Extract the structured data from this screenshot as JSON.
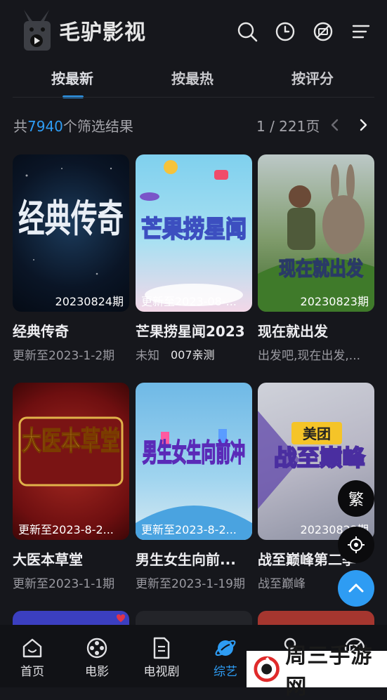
{
  "app": {
    "name": "毛驴影视"
  },
  "top_icons": [
    "search-icon",
    "history-icon",
    "no-ads-icon",
    "menu-icon"
  ],
  "tabs": [
    {
      "label": "按最新",
      "active": true
    },
    {
      "label": "按最热",
      "active": false
    },
    {
      "label": "按评分",
      "active": false
    }
  ],
  "filter": {
    "prefix": "共",
    "count": "7940",
    "suffix": "个筛选结果",
    "page": "1 / 221页"
  },
  "cards": [
    {
      "poster_text": "20230824期",
      "title": "经典传奇",
      "subtitle": "更新至2023-1-2期",
      "poster_art": "经典传奇"
    },
    {
      "poster_text": "更新至2023-08-...",
      "title": "芒果捞星闻2023",
      "subtitle": "未知",
      "subtitle_extra": "007亲测",
      "poster_art": "芒果捞星闻"
    },
    {
      "poster_text": "20230823期",
      "title": "现在就出发",
      "subtitle": "出发吧,现在出发,...",
      "poster_art": "现在就出发"
    },
    {
      "poster_text": "更新至2023-8-2...",
      "title": "大医本草堂",
      "subtitle": "更新至2023-1-1期",
      "poster_art": "大医本草堂"
    },
    {
      "poster_text": "更新至2023-8-2...",
      "title": "男生女生向前...",
      "subtitle": "更新至2023-1-19期",
      "poster_art": "男生女生向前冲"
    },
    {
      "poster_text": "20230823期",
      "title": "战至巅峰第二季",
      "subtitle": "战至巅峰",
      "poster_art": "战至巅峰",
      "poster_brand": "美团"
    }
  ],
  "floating": {
    "traditional_label": "繁"
  },
  "bottom_nav": [
    {
      "label": "首页",
      "icon": "home-icon",
      "active": false
    },
    {
      "label": "电影",
      "icon": "film-reel-icon",
      "active": false
    },
    {
      "label": "电视剧",
      "icon": "document-icon",
      "active": false
    },
    {
      "label": "综艺",
      "icon": "planet-icon",
      "active": true
    },
    {
      "label": "",
      "icon": "user-icon",
      "active": false
    },
    {
      "label": "",
      "icon": "no-ads-icon",
      "active": false
    }
  ],
  "watermark": {
    "text": "周三手游网"
  },
  "colors": {
    "accent": "#2e9cf3",
    "background": "#16171c",
    "nav_background": "#111216"
  }
}
